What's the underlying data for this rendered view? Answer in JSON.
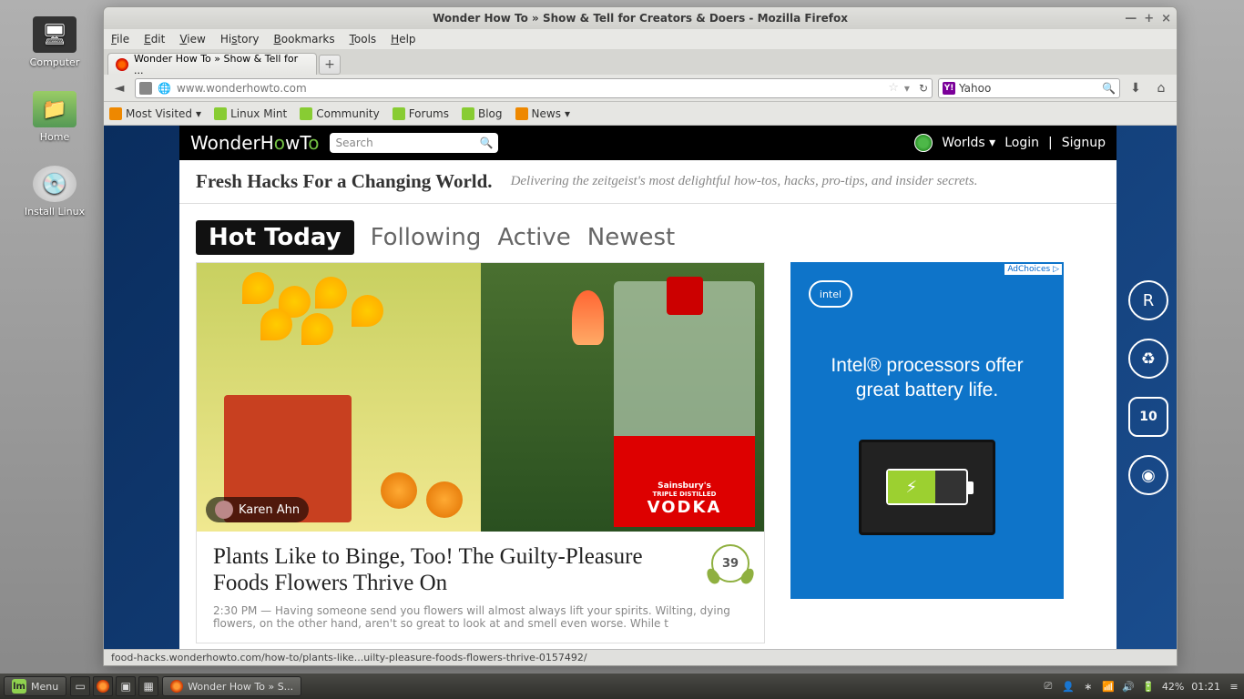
{
  "desktop": {
    "icons": [
      {
        "label": "Computer"
      },
      {
        "label": "Home"
      },
      {
        "label": "Install Linux"
      }
    ]
  },
  "window": {
    "title": "Wonder How To » Show & Tell for Creators & Doers - Mozilla Firefox",
    "menubar": [
      "File",
      "Edit",
      "View",
      "History",
      "Bookmarks",
      "Tools",
      "Help"
    ],
    "tab_label": "Wonder How To » Show & Tell for ...",
    "url": "www.wonderhowto.com",
    "search_engine": "Yahoo",
    "bookmarks": [
      "Most Visited",
      "Linux Mint",
      "Community",
      "Forums",
      "Blog",
      "News"
    ],
    "status_url": "food-hacks.wonderhowto.com/how-to/plants-like...uilty-pleasure-foods-flowers-thrive-0157492/"
  },
  "site": {
    "logo": "WonderHowTo",
    "search_placeholder": "Search",
    "worlds": "Worlds",
    "login": "Login",
    "signup": "Signup",
    "tagline_main": "Fresh Hacks For a Changing World.",
    "tagline_sub": "Delivering the zeitgeist's most delightful how-tos, hacks, pro-tips, and insider secrets.",
    "tabs": [
      "Hot Today",
      "Following",
      "Active",
      "Newest"
    ],
    "article": {
      "author": "Karen Ahn",
      "title": "Plants Like to Binge, Too! The Guilty-Pleasure Foods Flowers Thrive On",
      "time": "2:30 PM",
      "excerpt": "Having someone send you flowers will almost always lift your spirits. Wilting, dying flowers, on the other hand, aren't so great to look at and smell even worse. While t",
      "vodka_brand": "Sainsbury's",
      "vodka_sub": "TRIPLE DISTILLED",
      "vodka_text": "VODKA",
      "count": "39"
    },
    "ad": {
      "choices": "AdChoices",
      "brand": "intel",
      "text": "Intel® processors offer great battery life."
    },
    "side_badges": [
      "R",
      "↻",
      "10",
      "👁"
    ]
  },
  "taskbar": {
    "menu": "Menu",
    "window": "Wonder How To » S...",
    "battery": "42%",
    "time": "01:21"
  }
}
